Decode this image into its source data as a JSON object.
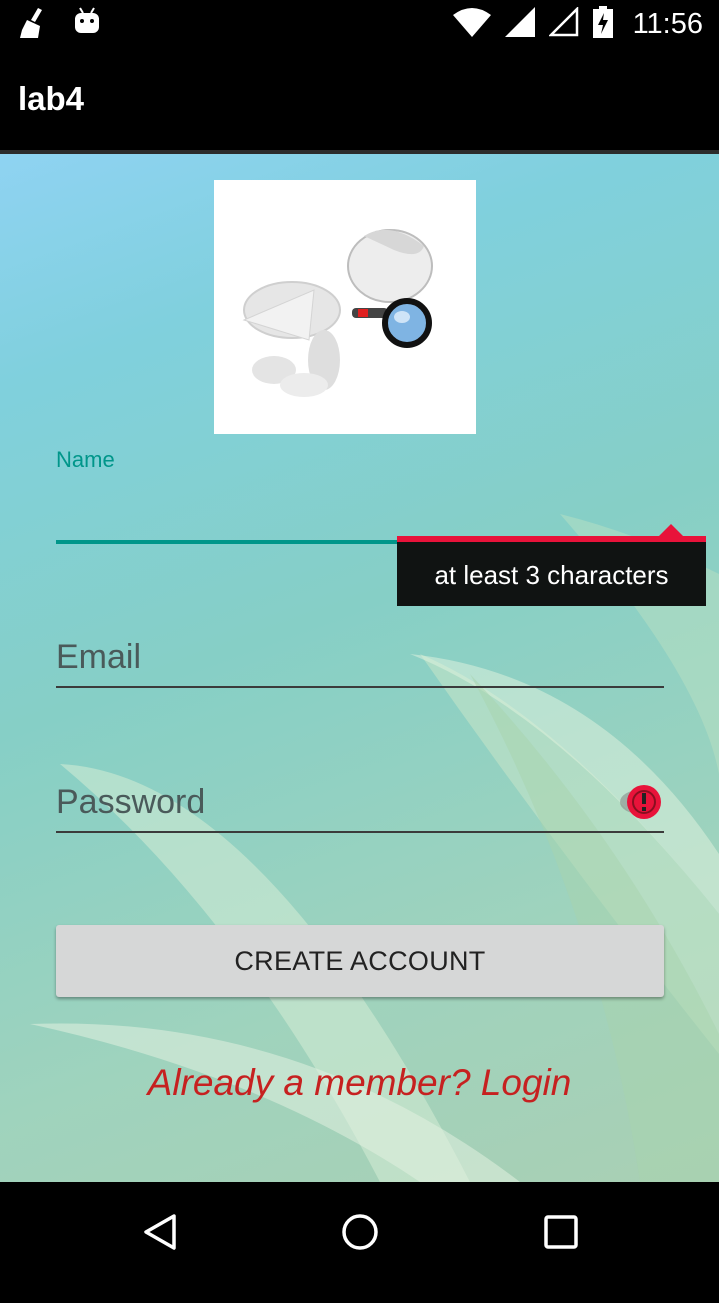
{
  "status_bar": {
    "time": "11:56",
    "icons": [
      "broom-cleaner-icon",
      "android-robot-icon",
      "wifi-icon",
      "cell-signal-icon",
      "cell-signal-empty-icon",
      "battery-charging-icon"
    ]
  },
  "app_bar": {
    "title": "lab4"
  },
  "form": {
    "name_label": "Name",
    "name_value": "",
    "name_error": "at least 3 characters",
    "email_placeholder": "Email",
    "email_value": "",
    "password_placeholder": "Password",
    "password_value": "",
    "create_button_label": "CREATE ACCOUNT",
    "login_link": "Already a member? Login"
  },
  "colors": {
    "accent": "#00968a",
    "error": "#e8133a",
    "link": "#c62120",
    "button": "#d6d7d7"
  },
  "nav_bar": {
    "buttons": [
      "back-icon",
      "home-icon",
      "recents-icon"
    ]
  }
}
